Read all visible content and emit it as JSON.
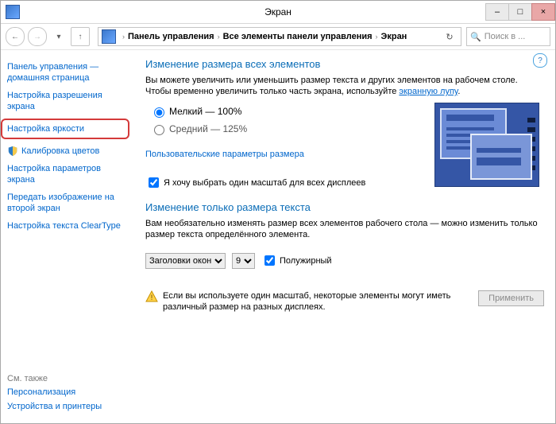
{
  "window": {
    "title": "Экран",
    "min_label": "–",
    "max_label": "□",
    "close_label": "×"
  },
  "addressbar": {
    "back_icon": "←",
    "fwd_icon": "→",
    "up_icon": "↑",
    "crumbs": [
      "Панель управления",
      "Все элементы панели управления",
      "Экран"
    ],
    "sep": "›",
    "refresh_icon": "↻",
    "search_placeholder": "Поиск в ..."
  },
  "sidebar": {
    "items": [
      {
        "label": "Панель управления — домашняя страница"
      },
      {
        "label": "Настройка разрешения экрана"
      },
      {
        "label": "Настройка яркости",
        "highlighted": true
      },
      {
        "label": "Калибровка цветов",
        "icon": "shield"
      },
      {
        "label": "Настройка параметров экрана"
      },
      {
        "label": "Передать изображение на второй экран"
      },
      {
        "label": "Настройка текста ClearType"
      }
    ],
    "see_also_hdr": "См. также",
    "see_also": [
      "Персонализация",
      "Устройства и принтеры"
    ]
  },
  "content": {
    "help_icon": "?",
    "section1_title": "Изменение размера всех элементов",
    "section1_desc_a": "Вы можете увеличить или уменьшить размер текста и других элементов на рабочем столе. Чтобы временно увеличить только часть экрана, используйте ",
    "section1_desc_link": "экранную лупу",
    "section1_desc_b": ".",
    "radios": [
      {
        "label": "Мелкий — 100%",
        "checked": true
      },
      {
        "label": "Средний — 125%",
        "checked": false
      }
    ],
    "custom_size_link": "Пользовательские параметры размера",
    "same_scale_checkbox": "Я хочу выбрать один масштаб для всех дисплеев",
    "section2_title": "Изменение только размера текста",
    "section2_desc": "Вам необязательно изменять размер всех элементов рабочего стола — можно изменить только размер текста определённого элемента.",
    "select_item": "Заголовки окон",
    "select_size": "9",
    "bold_checkbox": "Полужирный",
    "warning_text": "Если вы используете один масштаб, некоторые элементы могут иметь различный размер на разных дисплеях.",
    "apply_btn": "Применить"
  }
}
